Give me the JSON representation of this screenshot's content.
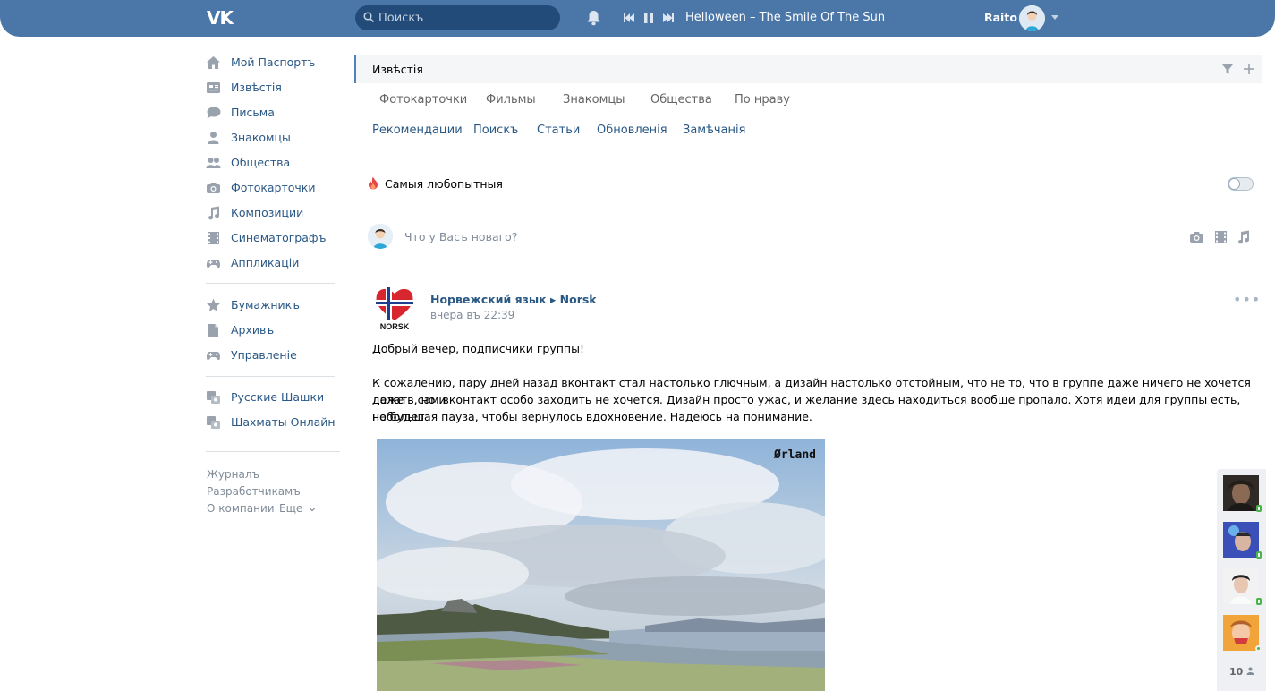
{
  "header": {
    "logo_text": "VK",
    "search_placeholder": "Поискъ",
    "track_title": "Helloween – The Smile Of The Sun",
    "user_name": "Raito"
  },
  "sidebar": {
    "items": [
      {
        "label": "Мой Паспортъ",
        "icon": "home-icon"
      },
      {
        "label": "Извѣстія",
        "icon": "news-icon"
      },
      {
        "label": "Письма",
        "icon": "messages-icon"
      },
      {
        "label": "Знакомцы",
        "icon": "friend-icon"
      },
      {
        "label": "Общества",
        "icon": "groups-icon"
      },
      {
        "label": "Фотокарточки",
        "icon": "camera-icon"
      },
      {
        "label": "Композиции",
        "icon": "music-icon"
      },
      {
        "label": "Синематографъ",
        "icon": "film-icon"
      },
      {
        "label": "Аппликаціи",
        "icon": "gamepad-icon"
      }
    ],
    "items2": [
      {
        "label": "Бумажникъ",
        "icon": "star-icon"
      },
      {
        "label": "Архивъ",
        "icon": "document-icon"
      },
      {
        "label": "Управленіе",
        "icon": "gamepad-icon"
      }
    ],
    "games": [
      {
        "label": "Русские Шашки",
        "icon": "game-app-icon"
      },
      {
        "label": "Шахматы Онлайн",
        "icon": "game-app-icon"
      }
    ],
    "footer": {
      "journal": "Журналъ",
      "developers": "Разработчикамъ",
      "about": "О компании",
      "more": "Еще"
    }
  },
  "feed": {
    "title": "Извѣстія",
    "tabs_row1": [
      "Фотокарточки",
      "Фильмы",
      "Знакомцы",
      "Общества",
      "По нраву"
    ],
    "tabs_row2": [
      "Рекомендации",
      "Поискъ",
      "Статьи",
      "Обновленія",
      "Замѣчанія"
    ],
    "interesting_label": "Самыя любопытныя",
    "composer_placeholder": "Что у Васъ новаго?"
  },
  "post": {
    "author": "Норвежский язык ▸ Norsk",
    "logo_text": "NORSK",
    "time": "вчера въ 22:39",
    "greeting": "Добрый вечер, подписчики группы!",
    "body_lines": [
      "К сожалению, пару дней назад вконтакт стал настолько глючным, а дизайн настолько отстойным, что не то, что в группе даже ничего не хочется делать, но и",
      "даже в сам вконтакт особо заходить не хочется. Дизайн просто ужас, и желание здесь находиться вообще пропало. Хотя идеи для группы есть, но будет",
      "небольшая пауза, чтобы вернулось вдохновение. Надеюсь на понимание."
    ],
    "image_caption": "Ørland"
  },
  "friends_bar": {
    "count": "10"
  },
  "colors": {
    "header_bg": "#4a76a8",
    "link": "#2a5885",
    "muted": "#818c99",
    "online": "#4bb34b"
  }
}
